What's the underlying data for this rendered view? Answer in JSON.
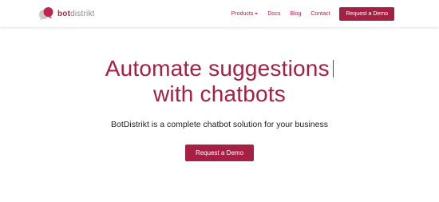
{
  "brand": {
    "part1": "bot",
    "part2": "distrikt",
    "logo_icon": "chat-bubbles-icon",
    "colors": {
      "primary": "#a62043",
      "secondary": "#8a8a8a"
    }
  },
  "nav": {
    "items": [
      {
        "label": "Products",
        "has_dropdown": true
      },
      {
        "label": "Docs"
      },
      {
        "label": "Blog"
      },
      {
        "label": "Contact"
      }
    ],
    "cta_label": "Request a Demo"
  },
  "hero": {
    "title_line1": "Automate suggestions",
    "title_line2": "with chatbots",
    "subtitle": "BotDistrikt is a complete chatbot solution for your business",
    "cta_label": "Request a Demo"
  }
}
